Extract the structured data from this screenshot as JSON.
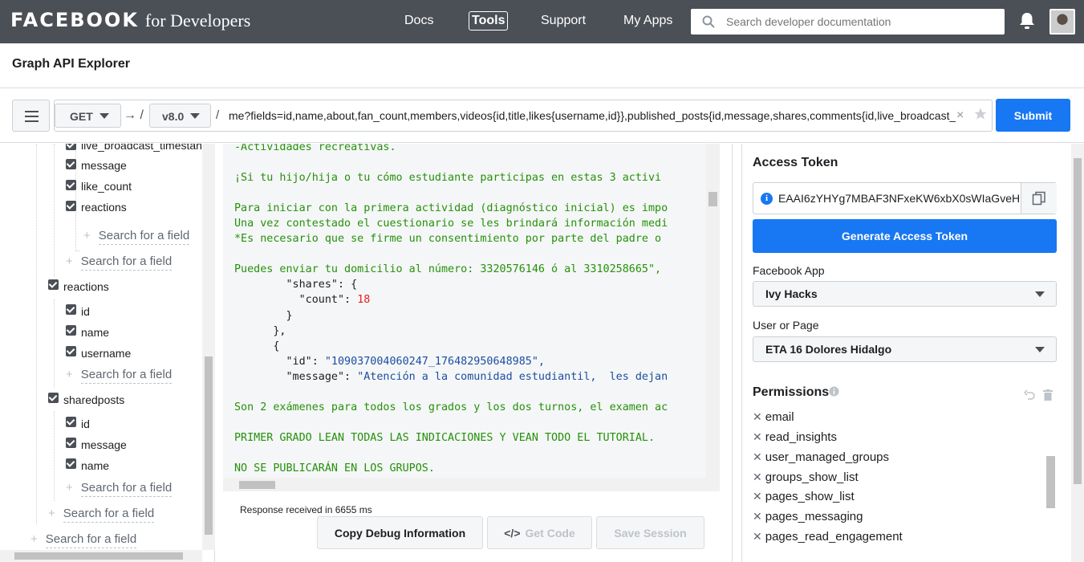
{
  "topnav": {
    "brand": "FACEBOOK",
    "brand_suffix": "for Developers",
    "links": [
      "Docs",
      "Tools",
      "Support",
      "My Apps"
    ],
    "search_placeholder": "Search developer documentation"
  },
  "page": {
    "title": "Graph API Explorer"
  },
  "query": {
    "method": "GET",
    "version": "v8.0",
    "arrow": "→ /",
    "slash": "/",
    "path": "me?fields=id,name,about,fan_count,members,videos{id,title,likes{username,id}},published_posts{id,message,shares,comments{id,live_broadcast_tim",
    "clear": "×",
    "submit_label": "Submit"
  },
  "fields": {
    "rows": [
      {
        "label": "live_broadcast_timestan"
      },
      {
        "label": "message"
      },
      {
        "label": "like_count"
      },
      {
        "label": "reactions"
      },
      {
        "label": "reactions"
      },
      {
        "label": "id"
      },
      {
        "label": "name"
      },
      {
        "label": "username"
      },
      {
        "label": "sharedposts"
      },
      {
        "label": "id"
      },
      {
        "label": "message"
      },
      {
        "label": "name"
      }
    ],
    "search_label": "Search for a field",
    "plus": "+"
  },
  "response": {
    "lines": [
      "-Actividades recreativas.",
      "",
      "¡Si tu hijo/hija o tu cómo estudiante participas en estas 3 activi",
      "",
      "Para iniciar con la primera actividad (diagnóstico inicial) es impo",
      "Una vez contestado el cuestionario se les brindará información medi",
      "*Es necesario que se firme un consentimiento por parte del padre o",
      "",
      "Puedes enviar tu domicilio al número: 3320576146 ó al 3310258665\",",
      "        \"shares\": {",
      "          \"count\": ",
      "        }",
      "      },",
      "      {",
      "        \"id\": ",
      "        \"message\": ",
      "",
      "Son 2 exámenes para todos los grados y los dos turnos, el examen ac",
      "",
      "PRIMER GRADO LEAN TODAS LAS INDICACIONES Y VEAN TODO EL TUTORIAL.",
      "",
      "NO SE PUBLICARÁN EN LOS GRUPOS."
    ],
    "count_value": "18",
    "id_value": "\"109037004060247_176482950648985\",",
    "message_value": "\"Atención a la comunidad estudiantil,  les dejan",
    "status": "Response received in 6655 ms",
    "buttons": {
      "debug": "Copy Debug Information",
      "code": "Get Code",
      "code_glyph": "</>",
      "session": "Save Session"
    }
  },
  "sidebar": {
    "token_title": "Access Token",
    "token_value": "EAAI6zYHYg7MBAF3NFxeKW6xbX0sWIaGveH",
    "info_glyph": "i",
    "generate_label": "Generate Access Token",
    "app_label": "Facebook App",
    "app_value": "Ivy Hacks",
    "user_label": "User or Page",
    "user_value": "ETA 16 Dolores Hidalgo",
    "permissions_title": "Permissions",
    "permissions": [
      "email",
      "read_insights",
      "user_managed_groups",
      "groups_show_list",
      "pages_show_list",
      "pages_messaging",
      "pages_read_engagement"
    ],
    "x_glyph": "✕"
  },
  "colors": {
    "nav_bg": "#4b4f56",
    "primary": "#1877f2",
    "code_green": "#25910b",
    "code_blue": "#1c4ea2",
    "code_red": "#e41e1e"
  }
}
